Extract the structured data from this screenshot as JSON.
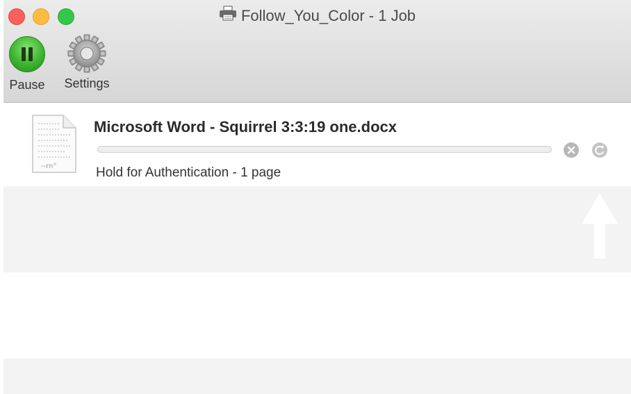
{
  "window": {
    "title": "Follow_You_Color - 1 Job",
    "title_icon": "printer-icon"
  },
  "toolbar": {
    "pause_label": "Pause",
    "settings_label": "Settings"
  },
  "job": {
    "name": "Microsoft Word - Squirrel 3:3:19 one.docx",
    "status": "Hold for Authentication - 1 page",
    "progress": 0,
    "icon": "document-icon"
  },
  "colors": {
    "close": "#fc605b",
    "minimize": "#fdbc40",
    "maximize": "#34c84a",
    "pause_button": "#3cb52e"
  }
}
